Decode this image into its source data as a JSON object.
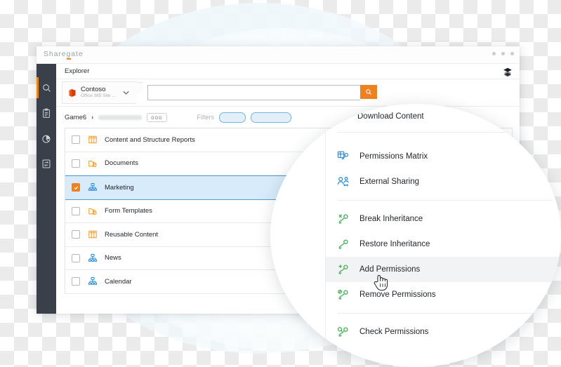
{
  "window": {
    "brand": "Sharegate",
    "controls": [
      "minimize-dot",
      "maximize-dot",
      "close-dot"
    ]
  },
  "header": {
    "explorer_label": "Explorer",
    "layers_icon": "layers-icon"
  },
  "site_tab": {
    "name": "Contoso",
    "subtitle": "Office 365 Site ...",
    "icon": "office365-icon",
    "chevron": "chevron-down-icon"
  },
  "search": {
    "value": "",
    "placeholder": "",
    "button_icon": "search-icon",
    "accent": "#ee8120"
  },
  "breadcrumb": {
    "root": "Game6",
    "separator": "›",
    "overflow_label": "ooo"
  },
  "filters": {
    "label": "Filters",
    "chips": [
      "",
      ""
    ],
    "chip_color": "#e3f0fb",
    "chip_border": "#74b3e4"
  },
  "rail": {
    "items": [
      {
        "name": "search",
        "icon": "search-icon",
        "active": true
      },
      {
        "name": "reports",
        "icon": "clipboard-icon",
        "active": false
      },
      {
        "name": "analytics",
        "icon": "pie-chart-icon",
        "active": false
      },
      {
        "name": "migration",
        "icon": "swap-arrows-icon",
        "active": false
      }
    ],
    "accent": "#f0821e",
    "background": "#3a4049"
  },
  "list": {
    "rows": [
      {
        "label": "Content and Structure Reports",
        "icon": "list-columns-icon",
        "icon_color": "#f0a030",
        "checked": false,
        "selected": false
      },
      {
        "label": "Documents",
        "icon": "document-library-icon",
        "icon_color": "#f0a030",
        "checked": false,
        "selected": false
      },
      {
        "label": "Marketing",
        "icon": "site-tree-icon",
        "icon_color": "#2f8fd8",
        "checked": true,
        "selected": true
      },
      {
        "label": "Form Templates",
        "icon": "document-library-icon",
        "icon_color": "#f0a030",
        "checked": false,
        "selected": false
      },
      {
        "label": "Reusable Content",
        "icon": "list-columns-icon",
        "icon_color": "#f0a030",
        "checked": false,
        "selected": false
      },
      {
        "label": "News",
        "icon": "site-tree-icon",
        "icon_color": "#2f8fd8",
        "checked": false,
        "selected": false
      },
      {
        "label": "Calendar",
        "icon": "site-tree-icon",
        "icon_color": "#2f8fd8",
        "checked": false,
        "selected": false
      }
    ],
    "selected_color": "#d7ebfa",
    "checkbox_checked_color": "#ee8120"
  },
  "context_menu": {
    "refresh_icon": "refresh-icon",
    "groups": [
      {
        "items": [
          {
            "label": "Download Content",
            "icon": "download-icon",
            "icon_color": "#f0821e",
            "highlighted": false
          }
        ]
      },
      {
        "items": [
          {
            "label": "Permissions Matrix",
            "icon": "permissions-matrix-icon",
            "icon_color": "#2f8fd8",
            "highlighted": false
          },
          {
            "label": "External Sharing",
            "icon": "external-sharing-icon",
            "icon_color": "#2f8fd8",
            "highlighted": false
          }
        ]
      },
      {
        "items": [
          {
            "label": "Break Inheritance",
            "icon": "break-inheritance-key-icon",
            "icon_color": "#44b055",
            "highlighted": false
          },
          {
            "label": "Restore Inheritance",
            "icon": "restore-inheritance-key-icon",
            "icon_color": "#44b055",
            "highlighted": false
          },
          {
            "label": "Add Permissions",
            "icon": "add-permissions-key-icon",
            "icon_color": "#44b055",
            "highlighted": true
          },
          {
            "label": "Remove Permissions",
            "icon": "remove-permissions-key-icon",
            "icon_color": "#44b055",
            "highlighted": false
          }
        ]
      },
      {
        "items": [
          {
            "label": "Check Permissions",
            "icon": "check-permissions-key-icon",
            "icon_color": "#44b055",
            "highlighted": false
          }
        ]
      }
    ]
  },
  "cursor": {
    "icon": "pointing-hand-cursor"
  }
}
